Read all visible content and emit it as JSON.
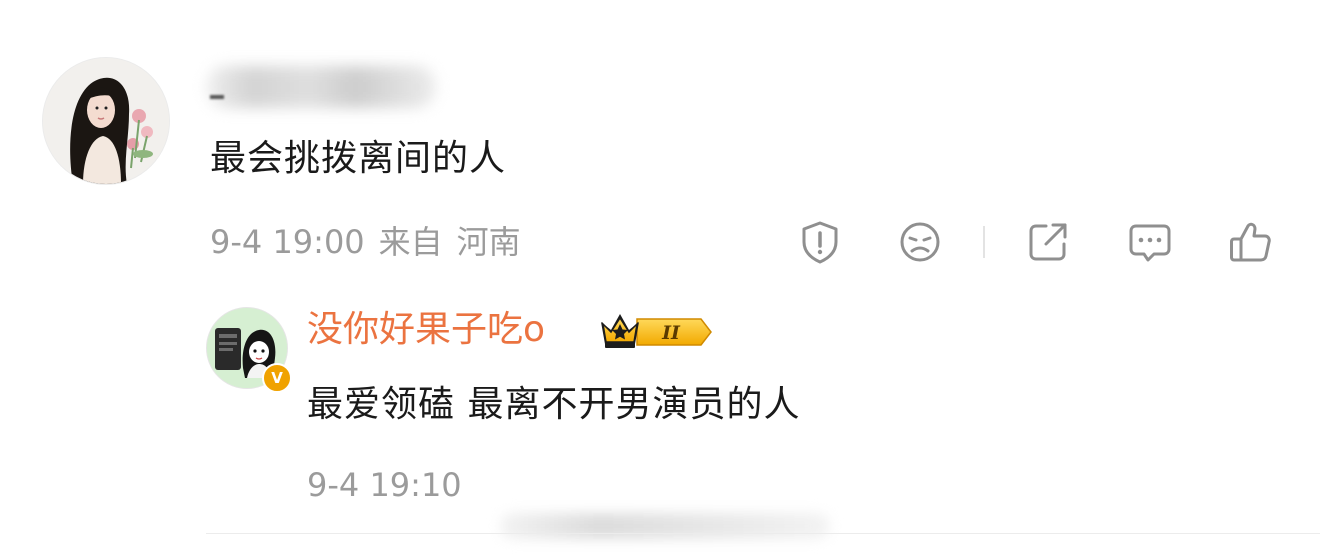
{
  "comment": {
    "text": "最会挑拨离间的人",
    "time": "9-4 19:00",
    "from_prefix": "来自",
    "location": "河南",
    "actions": {
      "report_icon": "shield-exclamation-icon",
      "dislike_icon": "sad-face-icon",
      "share_icon": "share-arrow-icon",
      "reply_icon": "chat-bubble-icon",
      "like_icon": "thumbs-up-icon"
    }
  },
  "reply": {
    "username": "没你好果子吃o",
    "verified_badge": "V",
    "level_badge": "II",
    "text": "最爱领磕 最离不开男演员的人",
    "time": "9-4 19:10"
  },
  "colors": {
    "username": "#eb7340",
    "meta_text": "#9b9b9b",
    "icon_gray": "#8f8f8f",
    "verified_badge": "#f0a200"
  }
}
